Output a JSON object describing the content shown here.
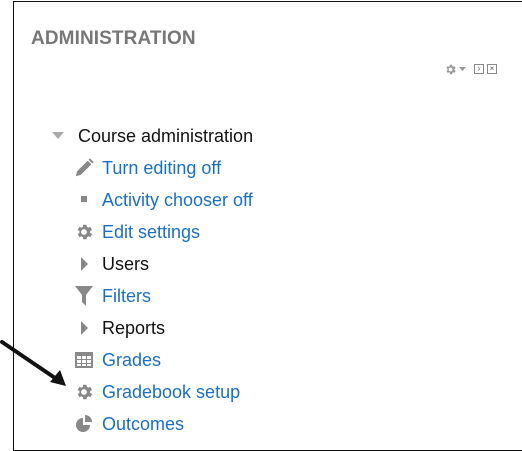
{
  "block": {
    "title": "ADMINISTRATION"
  },
  "controls": {
    "actions_icon": "gear-icon",
    "dock_icon": "dock-icon",
    "hide_icon": "hide-block-icon"
  },
  "tree": {
    "root_label": "Course administration",
    "items": [
      {
        "label": "Turn editing off",
        "icon": "pencil-icon",
        "type": "link"
      },
      {
        "label": "Activity chooser off",
        "icon": "bullet-icon",
        "type": "link"
      },
      {
        "label": "Edit settings",
        "icon": "gear-icon",
        "type": "link"
      },
      {
        "label": "Users",
        "icon": "expand-arrow-icon",
        "type": "branch"
      },
      {
        "label": "Filters",
        "icon": "filter-icon",
        "type": "link"
      },
      {
        "label": "Reports",
        "icon": "expand-arrow-icon",
        "type": "branch"
      },
      {
        "label": "Grades",
        "icon": "table-icon",
        "type": "link"
      },
      {
        "label": "Gradebook setup",
        "icon": "gear-icon",
        "type": "link"
      },
      {
        "label": "Outcomes",
        "icon": "outcomes-icon",
        "type": "link"
      }
    ]
  },
  "colors": {
    "link": "#1a6fc6",
    "text": "#111111",
    "title": "#777777",
    "icon": "#888888"
  }
}
